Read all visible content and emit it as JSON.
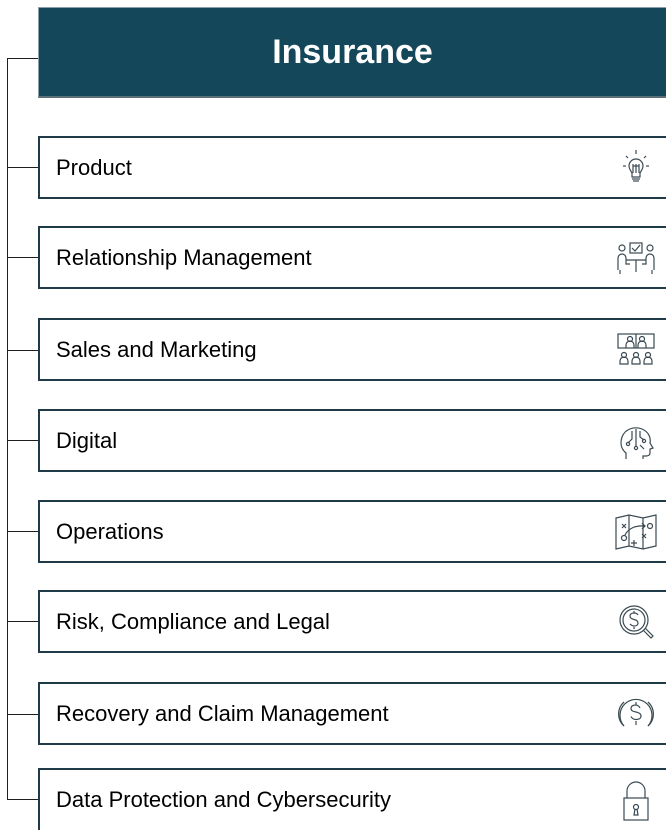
{
  "header": {
    "title": "Insurance",
    "background": "#134759"
  },
  "items": [
    {
      "label": "Product",
      "icon": "lightbulb-icon"
    },
    {
      "label": "Relationship Management",
      "icon": "meeting-icon"
    },
    {
      "label": "Sales and Marketing",
      "icon": "audience-icon"
    },
    {
      "label": "Digital",
      "icon": "ai-head-icon"
    },
    {
      "label": "Operations",
      "icon": "strategy-map-icon"
    },
    {
      "label": "Risk, Compliance and Legal",
      "icon": "dollar-search-icon"
    },
    {
      "label": "Recovery and Claim Management",
      "icon": "dollar-circle-icon"
    },
    {
      "label": "Data Protection and Cybersecurity",
      "icon": "lock-icon"
    }
  ]
}
